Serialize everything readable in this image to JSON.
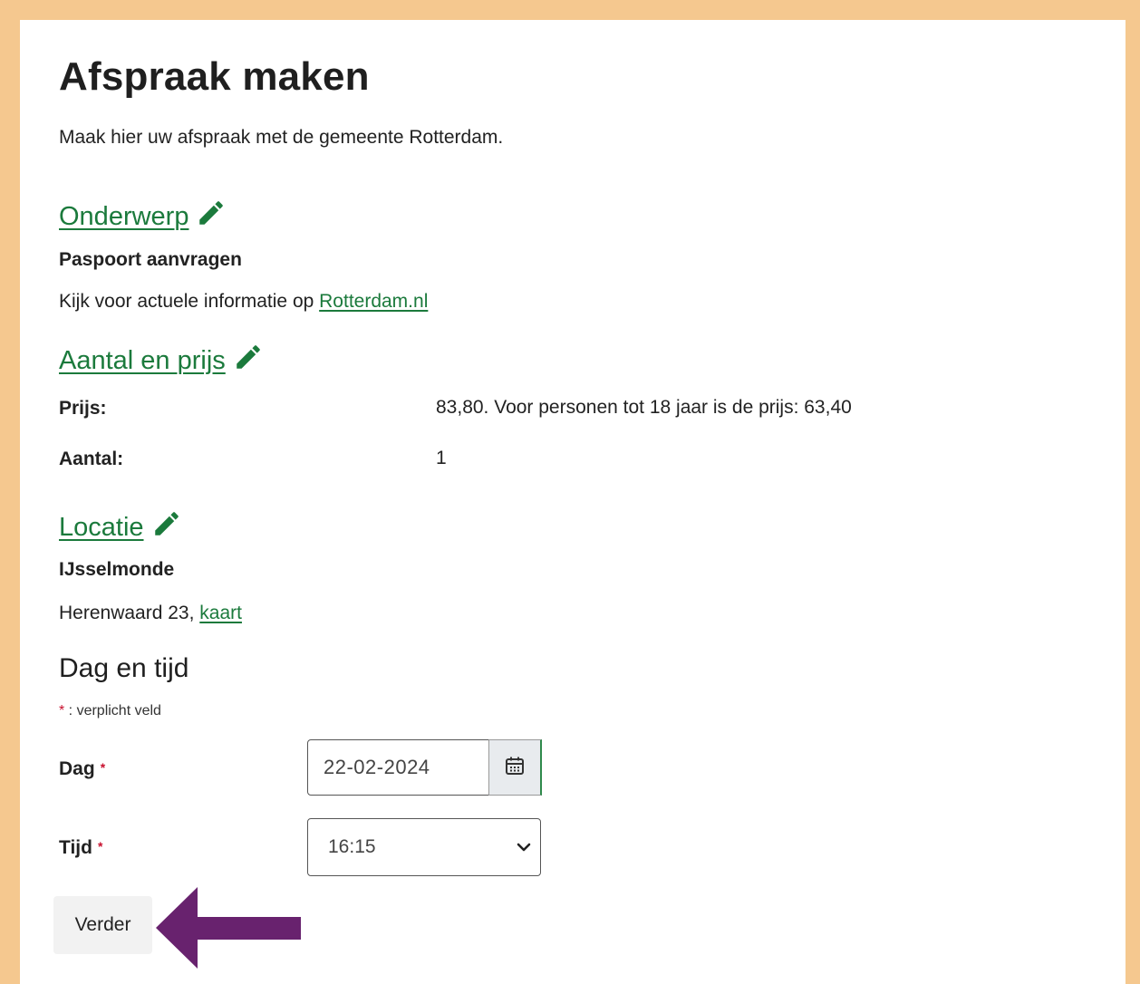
{
  "page": {
    "title": "Afspraak maken",
    "intro": "Maak hier uw afspraak met de gemeente Rotterdam."
  },
  "onderwerp": {
    "heading": "Onderwerp",
    "subject": "Paspoort aanvragen",
    "info_prefix": "Kijk voor actuele informatie op ",
    "info_link": "Rotterdam.nl"
  },
  "aantal_prijs": {
    "heading": "Aantal en prijs",
    "price_label": "Prijs:",
    "price_value": "83,80. Voor personen tot 18 jaar is de prijs: 63,40",
    "count_label": "Aantal:",
    "count_value": "1"
  },
  "locatie": {
    "heading": "Locatie",
    "name": "IJsselmonde",
    "address_prefix": "Herenwaard 23, ",
    "map_link": "kaart"
  },
  "dag_tijd": {
    "heading": "Dag en tijd",
    "required_star": "*",
    "required_note": " : verplicht veld",
    "day_label": "Dag",
    "day_value": "22-02-2024",
    "time_label": "Tijd",
    "time_value": "16:15"
  },
  "actions": {
    "continue_label": "Verder"
  },
  "icons": {
    "edit": "pencil-icon",
    "calendar": "calendar-icon",
    "dropdown": "chevron-down-icon",
    "annotation": "arrow-left-annotation"
  },
  "colors": {
    "frame_border": "#f5c88f",
    "link_green": "#1b7a3c",
    "required_red": "#c8102e",
    "annotation_purple": "#68226e"
  }
}
